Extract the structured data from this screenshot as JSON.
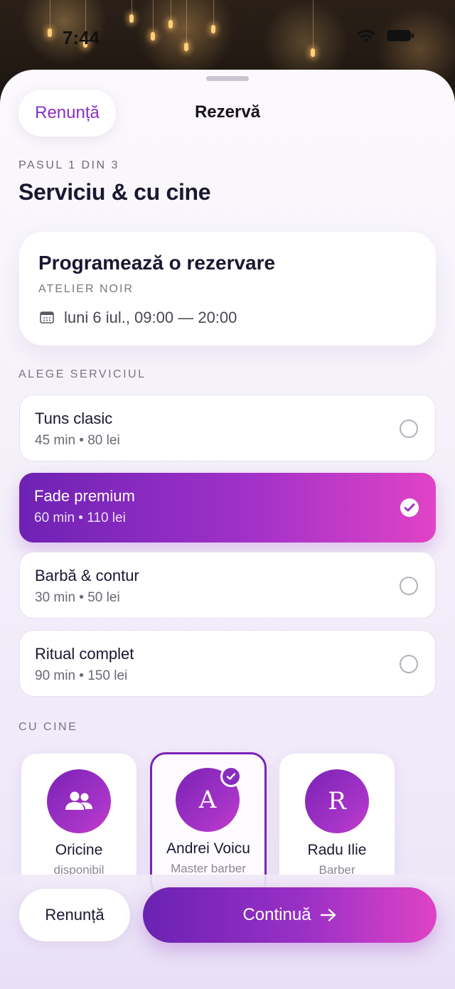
{
  "status_bar": {
    "time": "7:44"
  },
  "header": {
    "cancel_label": "Renunță",
    "title": "Rezervă"
  },
  "step": {
    "label": "PASUL 1 DIN 3",
    "title": "Serviciu & cu cine"
  },
  "booking_card": {
    "title": "Programează o rezervare",
    "venue": "ATELIER NOIR",
    "date_icon": "calendar-icon",
    "date_range": "luni 6 iul., 09:00 — 20:00"
  },
  "services_section": {
    "label": "ALEGE SERVICIUL",
    "items": [
      {
        "name": "Tuns clasic",
        "meta": "45 min • 80 lei",
        "selected": false
      },
      {
        "name": "Fade premium",
        "meta": "60 min • 110 lei",
        "selected": true
      },
      {
        "name": "Barbă & contur",
        "meta": "30 min • 50 lei",
        "selected": false
      },
      {
        "name": "Ritual complet",
        "meta": "90 min • 150 lei",
        "selected": false
      }
    ]
  },
  "staff_section": {
    "label": "CU CINE",
    "items": [
      {
        "name": "Oricine",
        "role": "disponibil",
        "avatar_icon": "people-icon",
        "selected": false
      },
      {
        "name": "Andrei Voicu",
        "role": "Master barber",
        "initial": "A",
        "selected": true
      },
      {
        "name": "Radu Ilie",
        "role": "Barber",
        "initial": "R",
        "selected": false
      }
    ]
  },
  "footer": {
    "cancel_label": "Renunță",
    "continue_label": "Continuă",
    "continue_icon": "arrow-right-icon"
  },
  "colors": {
    "accent": "#8a2fc4",
    "gradient_start": "#6a22b2",
    "gradient_end": "#df43c5",
    "text_dark": "#1b1730"
  }
}
